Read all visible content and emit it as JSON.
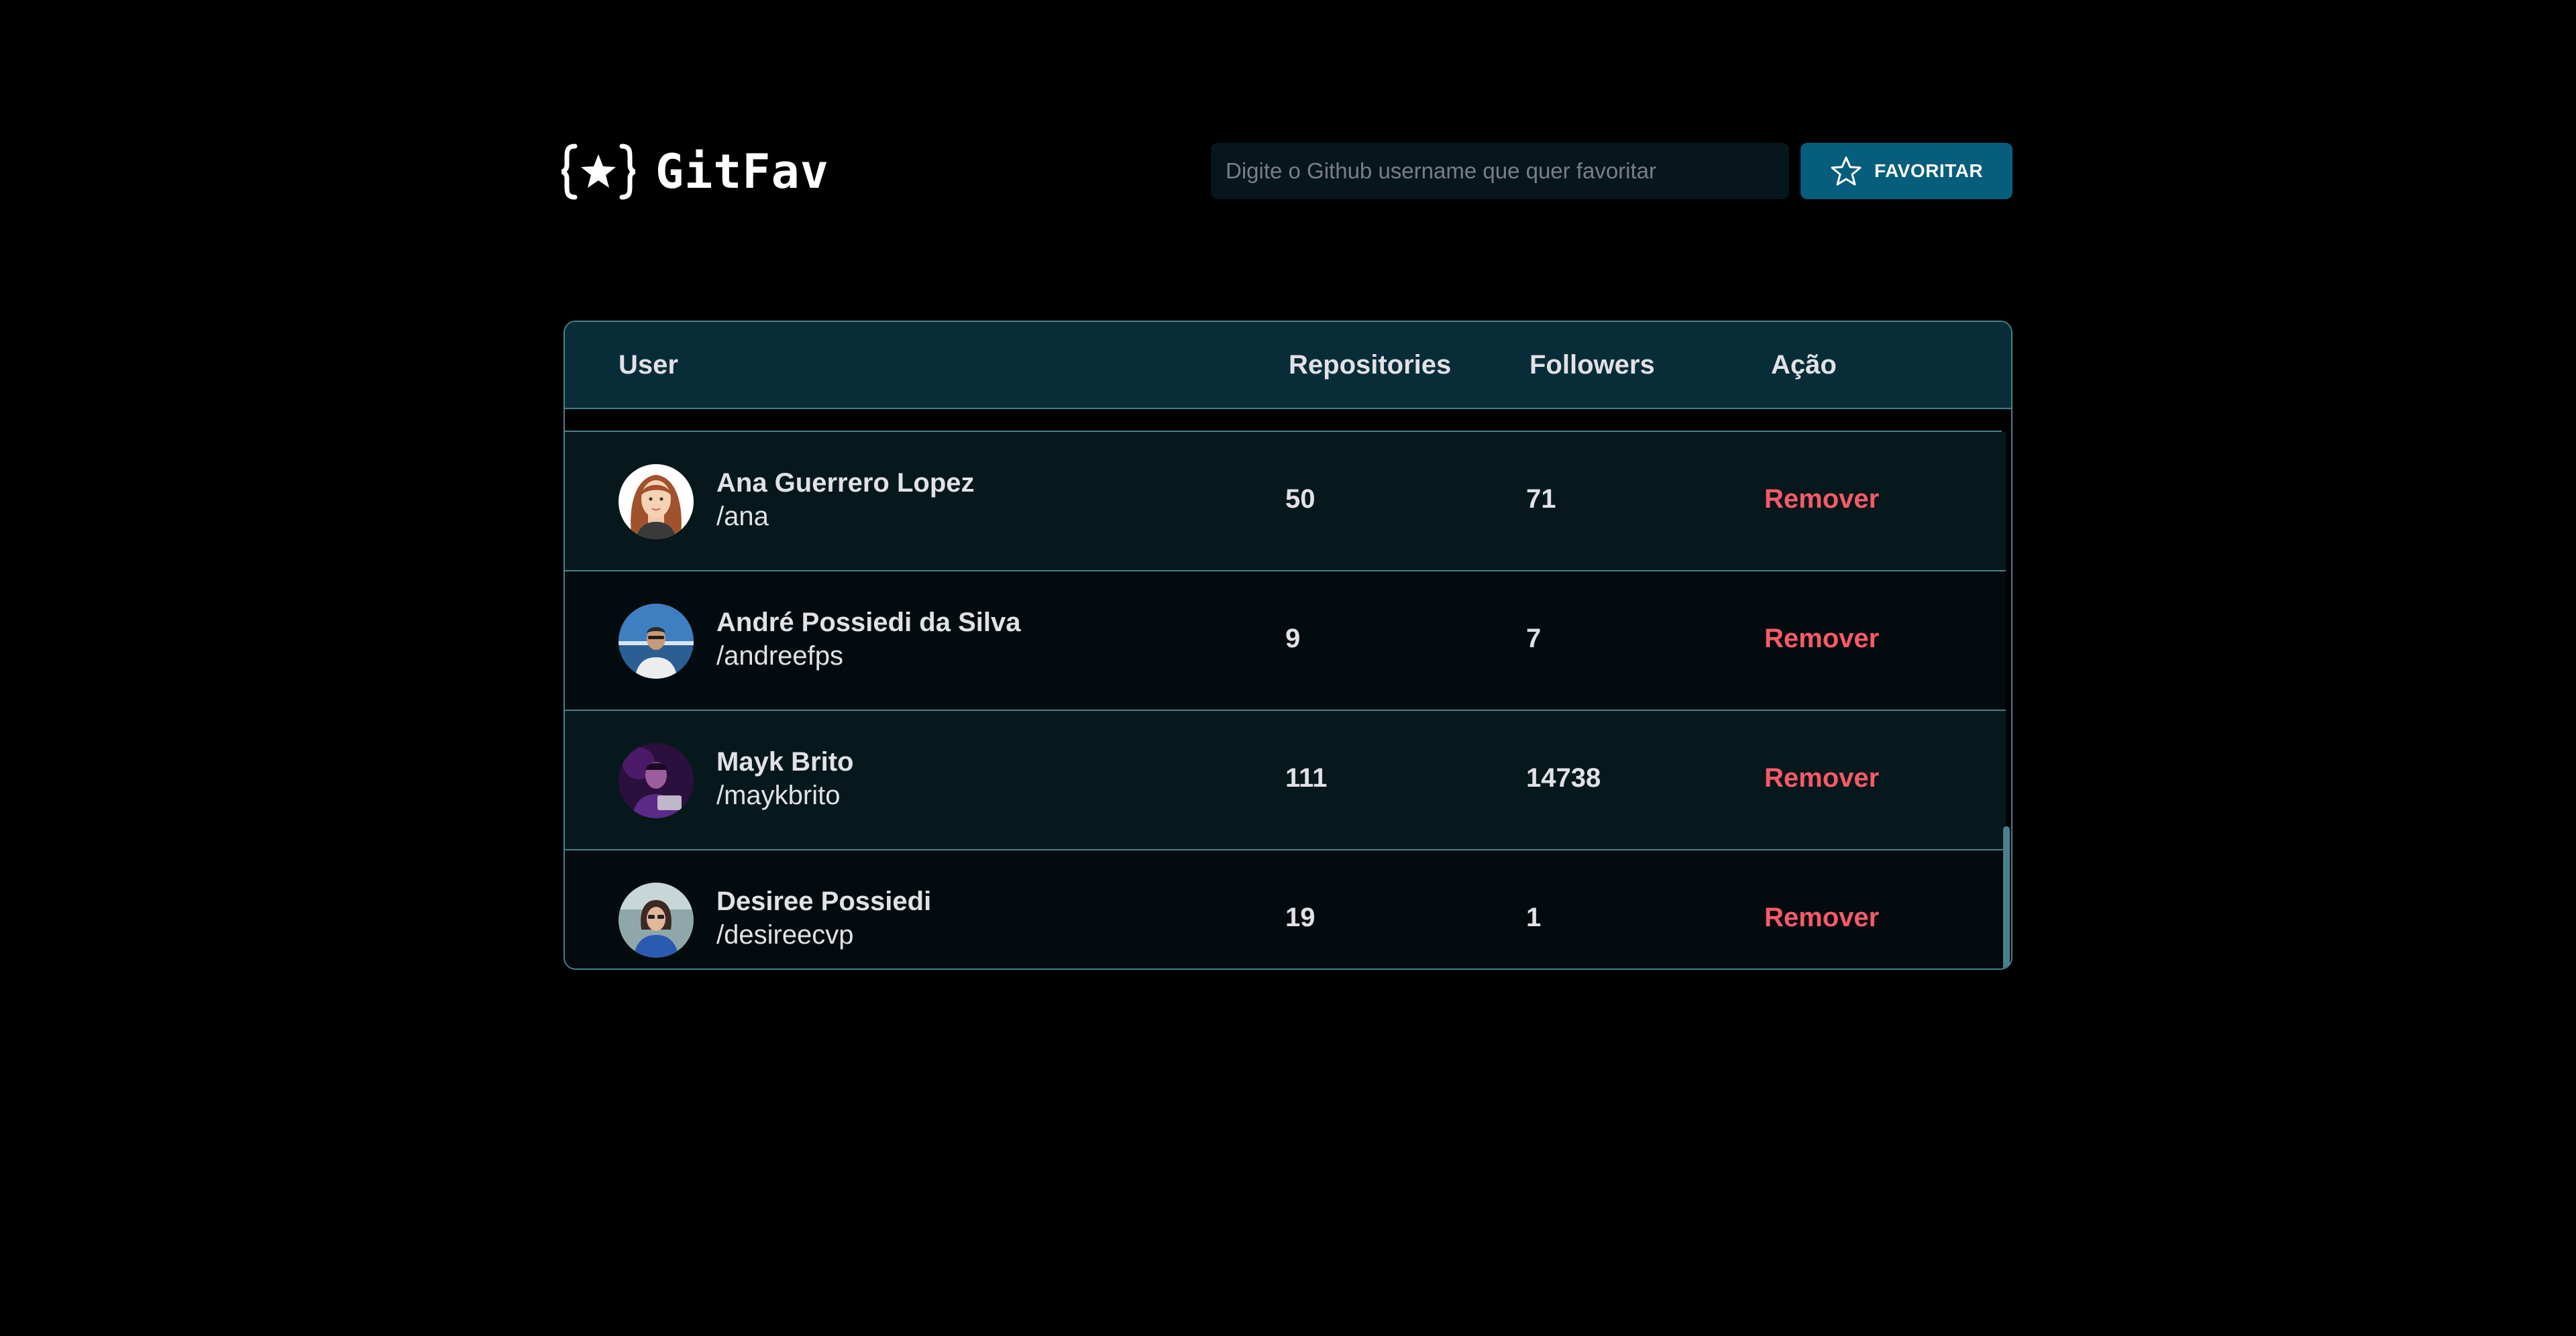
{
  "header": {
    "logo_text": "GitFav",
    "logo_icon": "braces-star-icon",
    "search_placeholder": "Digite o Github username que quer favoritar",
    "search_value": "",
    "favorite_button_label": "FAVORITAR",
    "favorite_button_icon": "star-outline-icon"
  },
  "table": {
    "columns": [
      "User",
      "Repositories",
      "Followers",
      "Ação"
    ],
    "rows": [
      {
        "name": "Ana Guerrero Lopez",
        "login": "/ana",
        "repositories": "50",
        "followers": "71",
        "action": "Remover"
      },
      {
        "name": "André Possiedi da Silva",
        "login": "/andreefps",
        "repositories": "9",
        "followers": "7",
        "action": "Remover"
      },
      {
        "name": "Mayk Brito",
        "login": "/maykbrito",
        "repositories": "111",
        "followers": "14738",
        "action": "Remover"
      },
      {
        "name": "Desiree Possiedi",
        "login": "/desireecvp",
        "repositories": "19",
        "followers": "1",
        "action": "Remover"
      }
    ]
  },
  "colors": {
    "background": "#000000",
    "header_bg": "#092D38",
    "row_odd": "#06181C",
    "row_even": "#030B0E",
    "border": "#4A808C",
    "button_bg": "#065E7C",
    "remove": "#F75A68"
  }
}
